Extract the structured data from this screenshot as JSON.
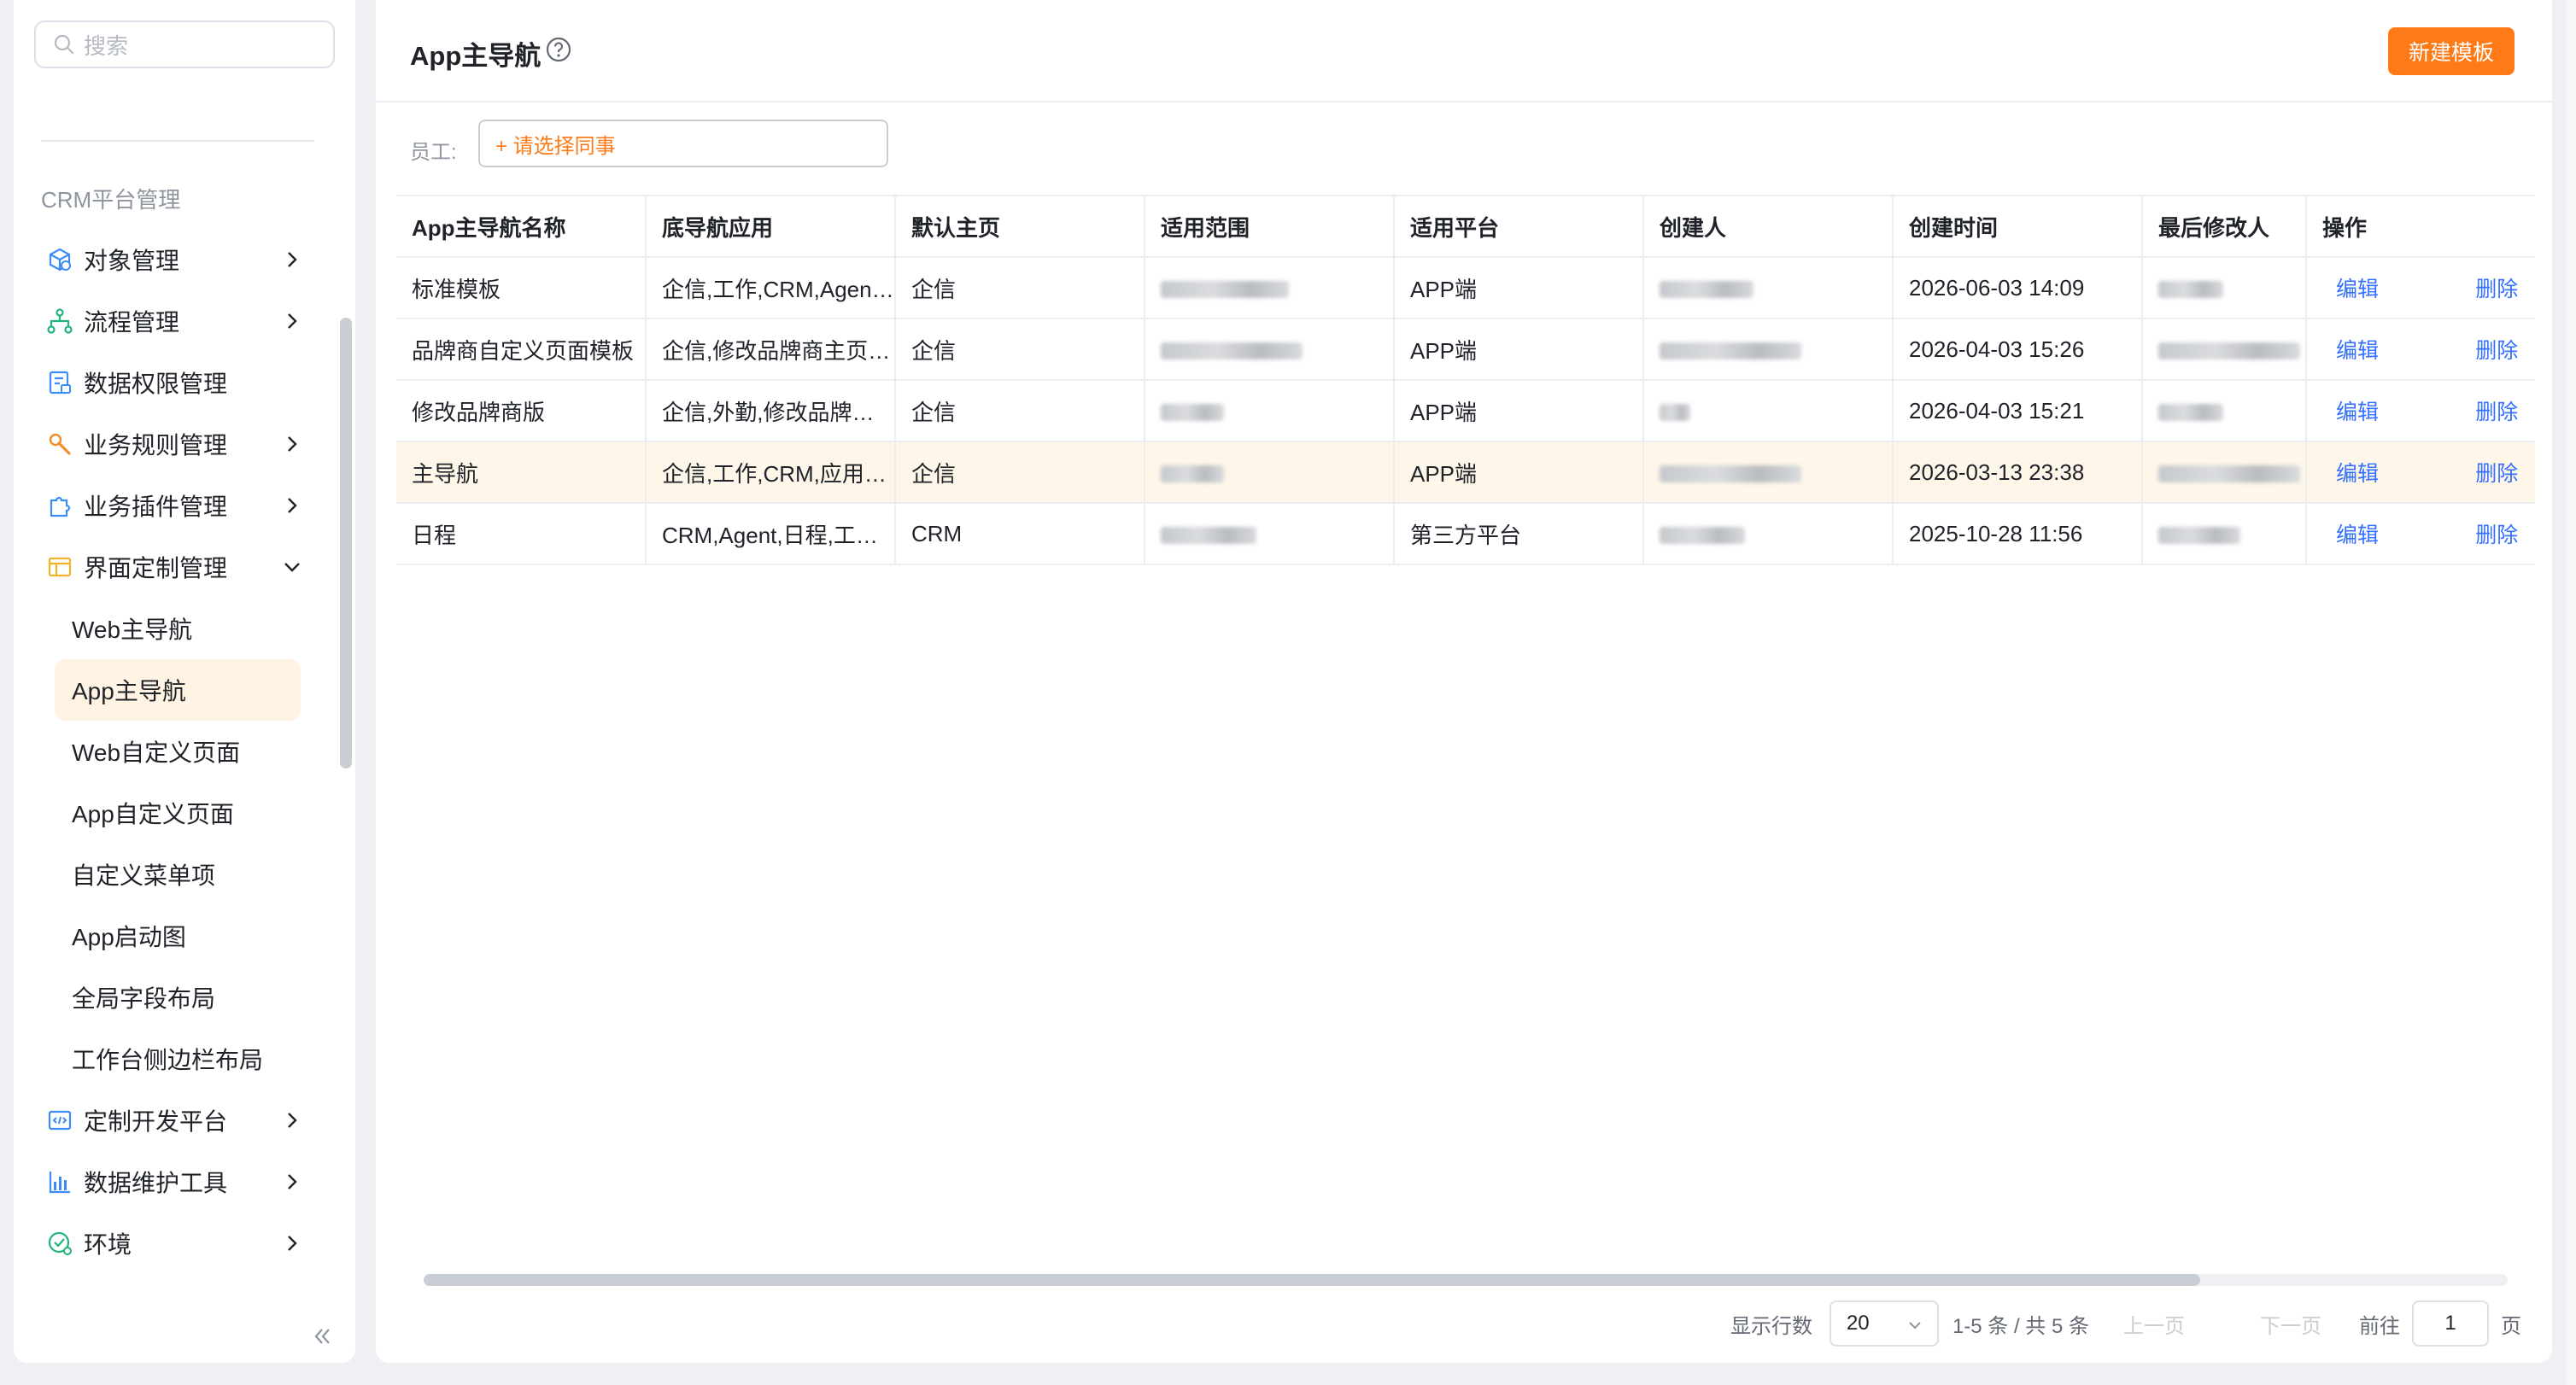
{
  "sidebar": {
    "search_placeholder": "搜索",
    "group_title": "CRM平台管理",
    "items": [
      {
        "label": "对象管理"
      },
      {
        "label": "流程管理"
      },
      {
        "label": "数据权限管理"
      },
      {
        "label": "业务规则管理"
      },
      {
        "label": "业务插件管理"
      },
      {
        "label": "界面定制管理"
      },
      {
        "label": "定制开发平台"
      },
      {
        "label": "数据维护工具"
      },
      {
        "label": "环境"
      }
    ],
    "sub_items": [
      {
        "label": "Web主导航"
      },
      {
        "label": "App主导航"
      },
      {
        "label": "Web自定义页面"
      },
      {
        "label": "App自定义页面"
      },
      {
        "label": "自定义菜单项"
      },
      {
        "label": "App启动图"
      },
      {
        "label": "全局字段布局"
      },
      {
        "label": "工作台侧边栏布局"
      }
    ]
  },
  "header": {
    "title": "App主导航",
    "new_button": "新建模板"
  },
  "filter": {
    "label": "员工:",
    "placeholder": "+ 请选择同事"
  },
  "table": {
    "columns": [
      "App主导航名称",
      "底导航应用",
      "默认主页",
      "适用范围",
      "适用平台",
      "创建人",
      "创建时间",
      "最后修改人",
      "操作"
    ],
    "rows": [
      {
        "name": "标准模板",
        "apps": "企信,工作,CRM,Agent,日程",
        "home": "企信",
        "platform": "APP端",
        "created": "2026-06-03 14:09"
      },
      {
        "name": "品牌商自定义页面模板",
        "apps": "企信,修改品牌商主页,工作",
        "home": "企信",
        "platform": "APP端",
        "created": "2026-04-03 15:26"
      },
      {
        "name": "修改品牌商版",
        "apps": "企信,外勤,修改品牌商主页",
        "home": "企信",
        "platform": "APP端",
        "created": "2026-04-03 15:21"
      },
      {
        "name": "主导航",
        "apps": "企信,工作,CRM,应用中心",
        "home": "企信",
        "platform": "APP端",
        "created": "2026-03-13 23:38"
      },
      {
        "name": "日程",
        "apps": "CRM,Agent,日程,工作台",
        "home": "CRM",
        "platform": "第三方平台",
        "created": "2025-10-28 11:56"
      }
    ],
    "edit_label": "编辑",
    "delete_label": "删除"
  },
  "pager": {
    "rows_label": "显示行数",
    "page_size": "20",
    "summary": "1-5 条 / 共 5 条",
    "prev": "上一页",
    "next": "下一页",
    "goto_label": "前往",
    "current_page": "1",
    "page_unit": "页"
  },
  "colors": {
    "accent": "#fe7a17",
    "link": "#3370ff",
    "active_bg": "#fff4e3",
    "highlight_row": "#fef6e9"
  }
}
